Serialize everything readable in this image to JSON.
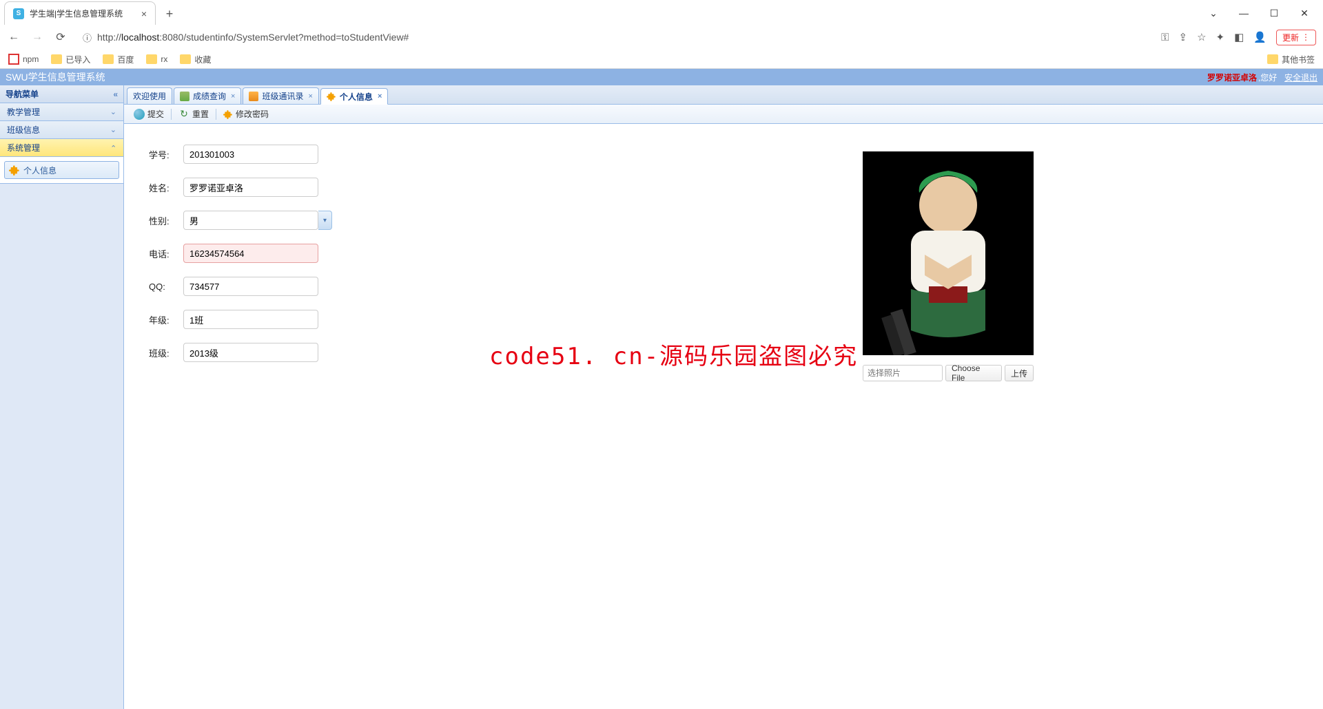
{
  "browser": {
    "tab_title": "学生端|学生信息管理系统",
    "url_prefix": "http://",
    "url_host": "localhost",
    "url_port_path": ":8080/studentinfo/SystemServlet?method=toStudentView#",
    "update_btn": "更新",
    "bookmarks": [
      "npm",
      "已导入",
      "百度",
      "rx",
      "收藏"
    ],
    "other_bookmarks": "其他书签"
  },
  "header": {
    "title": "SWU学生信息管理系统",
    "user": "罗罗诺亚卓洛",
    "greeting": ",您好",
    "logout": "安全退出"
  },
  "sidebar": {
    "title": "导航菜单",
    "items": [
      "教学管理",
      "班级信息",
      "系统管理"
    ],
    "sub_item": "个人信息"
  },
  "tabs": [
    {
      "label": "欢迎使用",
      "closable": false,
      "icon": ""
    },
    {
      "label": "成绩查询",
      "closable": true,
      "icon": "db"
    },
    {
      "label": "班级通讯录",
      "closable": true,
      "icon": "book"
    },
    {
      "label": "个人信息",
      "closable": true,
      "icon": "puzzle",
      "active": true
    }
  ],
  "toolbar": {
    "submit": "提交",
    "reset": "重置",
    "change_pw": "修改密码"
  },
  "form": {
    "labels": {
      "sid": "学号:",
      "name": "姓名:",
      "gender": "性别:",
      "phone": "电话:",
      "qq": "QQ:",
      "grade": "年级:",
      "clazz": "班级:"
    },
    "values": {
      "sid": "201301003",
      "name": "罗罗诺亚卓洛",
      "gender": "男",
      "phone": "16234574564",
      "qq": "734577",
      "grade": "1班",
      "clazz": "2013级"
    }
  },
  "photo": {
    "placeholder": "选择照片",
    "choose": "Choose File",
    "upload": "上传"
  },
  "watermark": "code51. cn-源码乐园盗图必究"
}
